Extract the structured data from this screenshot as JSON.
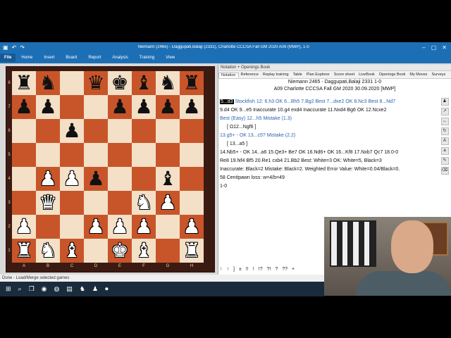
{
  "title_bar": {
    "title": "Niemann (2465) - Daggupati,Balaji (2331), Charlotte CCCSA Fall GM 2020  A09  (MWP), 1-0",
    "minimize": "–",
    "maximize": "▢",
    "close": "✕"
  },
  "ribbon": {
    "file": "File",
    "tabs": [
      "Home",
      "Insert",
      "Board",
      "Report",
      "Analysis",
      "Training",
      "View"
    ]
  },
  "board": {
    "ranks": [
      "8",
      "7",
      "6",
      "5",
      "4",
      "3",
      "2",
      "1"
    ],
    "files": [
      "A",
      "B",
      "C",
      "D",
      "E",
      "F",
      "G",
      "H"
    ],
    "squares": [
      [
        "br",
        "bn",
        "",
        "bq",
        "bk",
        "bb",
        "bn",
        "br"
      ],
      [
        "bp",
        "bp",
        "",
        "",
        "bp",
        "bp",
        "bp",
        "bp"
      ],
      [
        "",
        "",
        "bp",
        "",
        "",
        "",
        "",
        ""
      ],
      [
        "",
        "",
        "",
        "",
        "",
        "",
        "",
        ""
      ],
      [
        "",
        "wp",
        "wp",
        "bp",
        "",
        "",
        "bb",
        ""
      ],
      [
        "",
        "wq",
        "",
        "",
        "",
        "wn",
        "wp",
        ""
      ],
      [
        "wp",
        "",
        "",
        "wp",
        "wp",
        "wp",
        "",
        "wp"
      ],
      [
        "wr",
        "wn",
        "wb",
        "",
        "wk",
        "wb",
        "",
        "wr"
      ]
    ]
  },
  "panel": {
    "header": "Notation + Openings Book",
    "tabs": [
      "Notation",
      "Reference",
      "Replay training",
      "Table",
      "Plan Explorer",
      "Score sheet",
      "LiveBook",
      "Openings Book",
      "My Moves",
      "Surveys"
    ],
    "game_line1": "Niemann 2465 - Daggupati,Balaji 2331 1-0",
    "game_line2": "A09 Charlotte CCCSA Fall GM 2020 30.09.2020 [MWP]"
  },
  "notation": {
    "line1_cur": "5...d3",
    "line1_rest": "Stockfish 12:  6.h3 OK  6...Bh5  7.Bg2 Best  7...dxe2 OK  8.Nc3 Best  8...Nd7",
    "line2": "9.d4 OK  9...e5 Inaccurate  10.g4  exd4 Inaccurate  11.Nxd4  Bg6 OK  12.Ncxe2",
    "line3": "Best (Easy)  12...h5 Mistake (1.3)",
    "line4": "[ Ω12...Ngf6 ]",
    "line5": "13.g5+ - OK  13...c5? Mistake (2.2)",
    "line6": "[ 13...a5 ]",
    "line7": "14.Nb5+ - OK  14...a6  15.Qe3+  Be7 OK  16.Nd6+ OK  16...Kf8  17.Nxb7  Qc7  18.0-0",
    "line8": "Re8  19.Nf4  Bf5  20.Re1  cxb4  21.Bb2 Best:  White=3 OK: White=5, Black=3",
    "line9": "Inaccurate:  Black=2 Mistake:  Black=2.  Weighted  Error Value: White=0.04/Black=0.",
    "line10": "58 Centipawn loss: w=4/b=49",
    "line11": "1-0"
  },
  "bottom_toolbar": [
    "↑",
    "↑",
    "]",
    "±",
    "!!",
    "!",
    "!?",
    "?!",
    "?",
    "??",
    "+"
  ],
  "status": "Done - Load/Merge selected games",
  "colors": {
    "accent": "#1d6fb5",
    "light_square": "#f3e0c6",
    "dark_square": "#c8552a"
  }
}
